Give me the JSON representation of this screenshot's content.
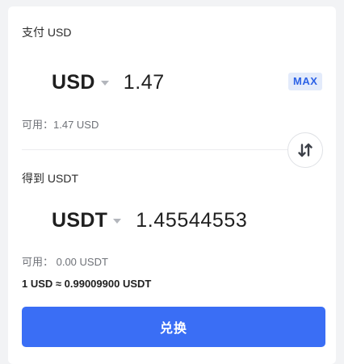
{
  "pay": {
    "label": "支付 USD",
    "currency": "USD",
    "amount": "1.47",
    "max_label": "MAX",
    "available": "可用：1.47 USD"
  },
  "receive": {
    "label": "得到 USDT",
    "currency": "USDT",
    "amount": "1.45544553",
    "available": "可用： 0.00 USDT"
  },
  "rate_text": "1 USD ≈ 0.99009900 USDT",
  "exchange_button_label": "兑换",
  "colors": {
    "accent": "#3a6ef5",
    "max_text": "#2c62e6",
    "max_bg": "#e3ebfb",
    "muted_text": "#6f7278"
  },
  "icons": {
    "currency_dropdown": "caret-down-icon",
    "swap": "swap-arrows-icon"
  }
}
